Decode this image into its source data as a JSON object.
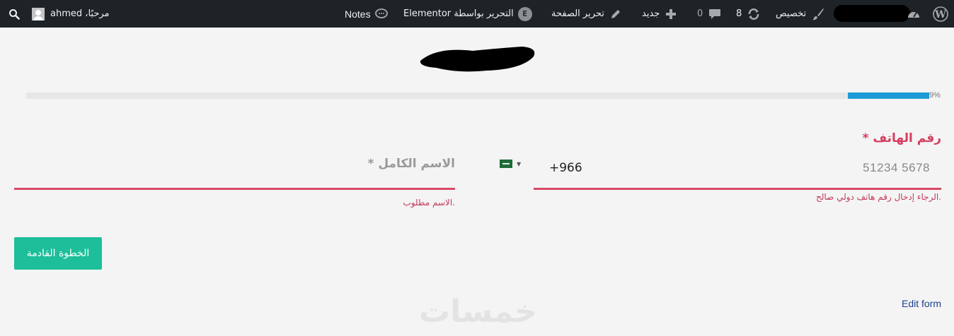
{
  "admin_bar": {
    "greeting": "مرحبًا، ahmed",
    "notes": "Notes",
    "elementor": "التحرير بواسطة Elementor",
    "edit_page": "تحرير الصفحة",
    "new": "جديد",
    "comments_count": "0",
    "updates_count": "8",
    "customize": "تخصيص",
    "icons": [
      "search-icon",
      "avatar",
      "notes-icon",
      "elementor-icon",
      "pencil-icon",
      "plus-icon",
      "comment-icon",
      "updates-icon",
      "brush-icon",
      "dashboard-icon",
      "wordpress-logo-icon"
    ]
  },
  "progress": {
    "value": 9,
    "label": "9%",
    "color": "#1e9bd7"
  },
  "phone": {
    "label": "رقم الهاتف *",
    "country_code": "+966",
    "placeholder": "51234 5678",
    "error": ".الرجاء إدخال رقم هاتف دولي صالح",
    "flag": "saudi-arabia-flag-icon"
  },
  "name": {
    "placeholder": "الاسم الكامل *",
    "error": ".الاسم مطلوب"
  },
  "next_button": "الخطوة القادمة",
  "edit_form": "Edit form",
  "watermark": "خمسات",
  "colors": {
    "accent": "#1dbf9a",
    "error": "#d94968",
    "adminbar": "#1d2327"
  }
}
